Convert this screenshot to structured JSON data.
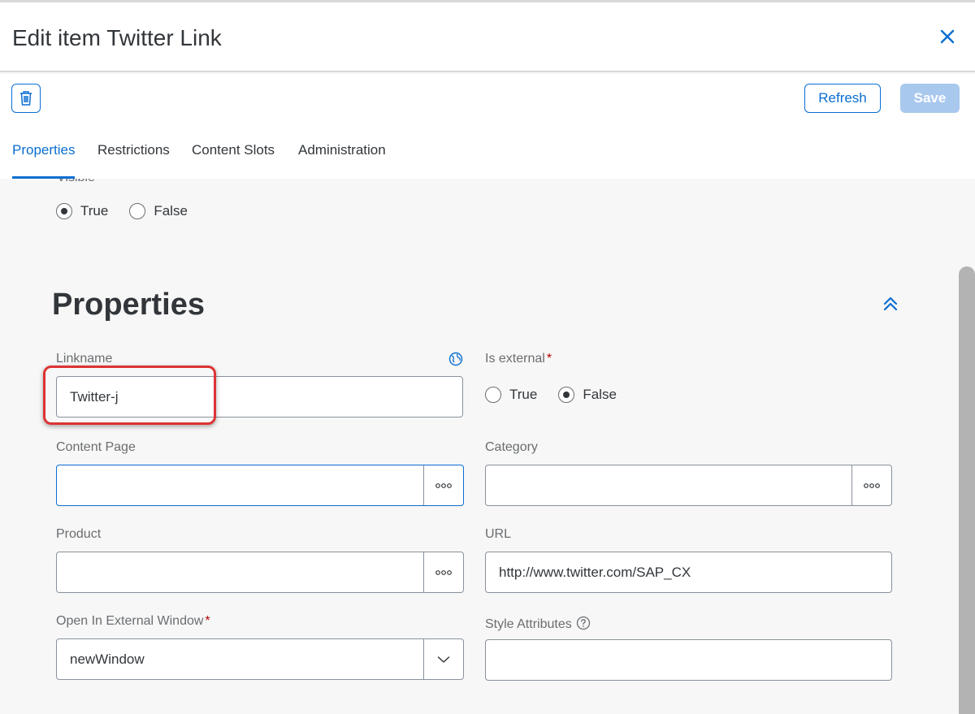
{
  "dialog": {
    "title": "Edit item Twitter Link"
  },
  "toolbar": {
    "refresh_label": "Refresh",
    "save_label": "Save"
  },
  "tabs": [
    {
      "label": "Properties",
      "active": true
    },
    {
      "label": "Restrictions",
      "active": false
    },
    {
      "label": "Content Slots",
      "active": false
    },
    {
      "label": "Administration",
      "active": false
    }
  ],
  "visible": {
    "label": "Visible",
    "options": [
      {
        "label": "True",
        "checked": true
      },
      {
        "label": "False",
        "checked": false
      }
    ]
  },
  "section": {
    "title": "Properties"
  },
  "fields": {
    "linkname": {
      "label": "Linkname",
      "value": "Twitter-j"
    },
    "is_external": {
      "label": "Is external",
      "required": "*",
      "options": [
        {
          "label": "True",
          "checked": false
        },
        {
          "label": "False",
          "checked": true
        }
      ]
    },
    "content_page": {
      "label": "Content Page",
      "value": ""
    },
    "category": {
      "label": "Category",
      "value": ""
    },
    "product": {
      "label": "Product",
      "value": ""
    },
    "url": {
      "label": "URL",
      "value": "http://www.twitter.com/SAP_CX"
    },
    "open_in_external_window": {
      "label": "Open In External Window",
      "required": "*",
      "value": "newWindow"
    },
    "style_attributes": {
      "label": "Style Attributes",
      "value": ""
    }
  },
  "colors": {
    "accent": "#0a6ed1",
    "required": "#bb0000",
    "highlight": "#dd3333",
    "save_disabled": "#a8c8ee"
  },
  "icons": [
    "close-icon",
    "trash-icon",
    "collapse-icon",
    "globe-icon",
    "value-help-icon",
    "chevron-down-icon",
    "help-icon"
  ]
}
